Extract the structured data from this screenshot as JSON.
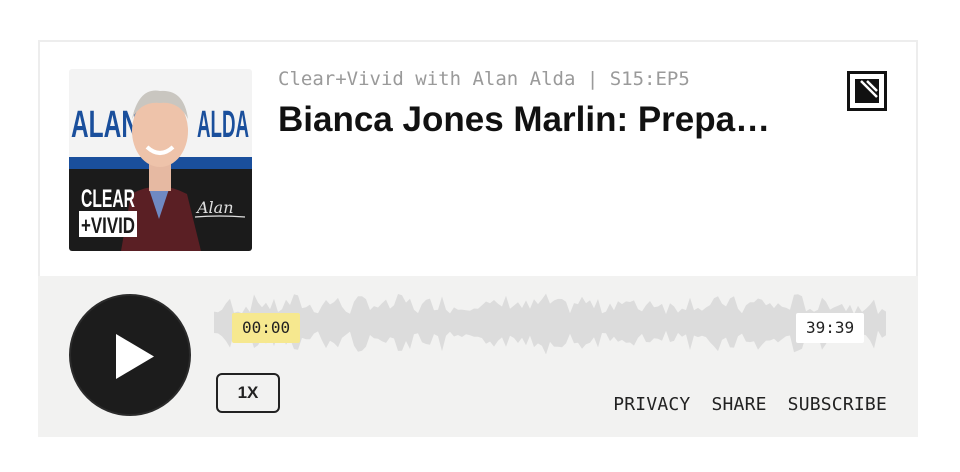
{
  "episode": {
    "show_line": "Clear+Vivid with Alan Alda | S15:EP5",
    "title": "Bianca Jones Marlin: Prepa…"
  },
  "artwork": {
    "name_left": "ALAN",
    "name_right": "ALDA",
    "brand_top": "CLEAR",
    "brand_bottom": "+VIVID",
    "signature": "Alan",
    "colors": {
      "blue": "#1a4f9c",
      "maroon": "#5a1f24",
      "dark": "#1b1b1b"
    }
  },
  "logo": {
    "icon": "publisher-logo-icon"
  },
  "player": {
    "play_icon": "play-icon",
    "current_time": "00:00",
    "total_time": "39:39",
    "speed": "1X",
    "progress": 0,
    "colors": {
      "background": "#f2f2f1",
      "waveform": "#dcdcdc",
      "time_highlight": "#f6e88f",
      "button": "#1c1c1c"
    }
  },
  "links": {
    "privacy": "PRIVACY",
    "share": "SHARE",
    "subscribe": "SUBSCRIBE"
  }
}
